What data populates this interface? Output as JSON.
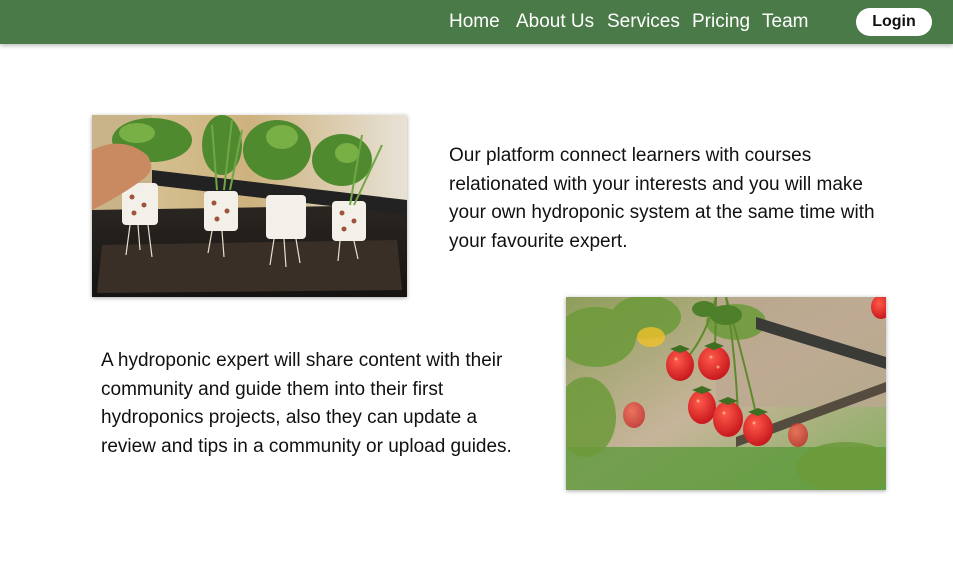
{
  "nav": {
    "links": [
      "Home",
      "About Us",
      "Services",
      "Pricing",
      "Team"
    ],
    "login_label": "Login"
  },
  "sections": {
    "first_paragraph": "Our platform connect learners with courses relationated with your interests and you will make your own hydroponic system at the same time with your favourite expert.",
    "second_paragraph": "A hydroponic expert will share content with their community and guide them into their first hydroponics projects, also they can update a review and tips in a community or upload guides."
  },
  "colors": {
    "nav_background": "#4a7a47",
    "nav_text": "#ffffff",
    "login_background": "#ffffff"
  }
}
